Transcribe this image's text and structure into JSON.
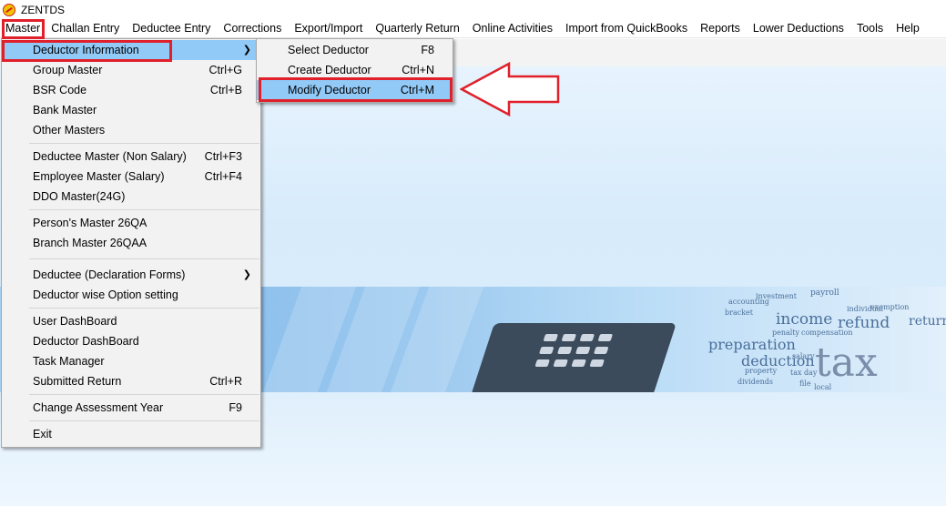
{
  "app": {
    "title": "ZENTDS",
    "icon": "app-logo-icon"
  },
  "menubar": [
    "Master",
    "Challan Entry",
    "Deductee Entry",
    "Corrections",
    "Export/Import",
    "Quarterly Return",
    "Online Activities",
    "Import from QuickBooks",
    "Reports",
    "Lower Deductions",
    "Tools",
    "Help"
  ],
  "master_menu": {
    "deductor_information": "Deductor Information",
    "group_master": {
      "label": "Group Master",
      "shortcut": "Ctrl+G"
    },
    "bsr_code": {
      "label": "BSR Code",
      "shortcut": "Ctrl+B"
    },
    "bank_master": "Bank Master",
    "other_masters": "Other Masters",
    "deductee_master_non_salary": {
      "label": "Deductee Master (Non Salary)",
      "shortcut": "Ctrl+F3"
    },
    "employee_master_salary": {
      "label": "Employee Master (Salary)",
      "shortcut": "Ctrl+F4"
    },
    "ddo_master": "DDO Master(24G)",
    "persons_master": "Person's Master 26QA",
    "branch_master": "Branch Master 26QAA",
    "deductee_declaration": "Deductee (Declaration Forms)",
    "deductor_option_setting": "Deductor wise Option setting",
    "user_dashboard": "User DashBoard",
    "deductor_dashboard": "Deductor DashBoard",
    "task_manager": "Task Manager",
    "submitted_return": {
      "label": "Submitted Return",
      "shortcut": "Ctrl+R"
    },
    "change_assessment_year": {
      "label": "Change Assessment Year",
      "shortcut": "F9"
    },
    "exit": "Exit"
  },
  "submenu": {
    "select_deductor": {
      "label": "Select Deductor",
      "shortcut": "F8"
    },
    "create_deductor": {
      "label": "Create Deductor",
      "shortcut": "Ctrl+N"
    },
    "modify_deductor": {
      "label": "Modify Deductor",
      "shortcut": "Ctrl+M"
    }
  },
  "banner_words": [
    "payroll",
    "investment",
    "accounting",
    "bracket",
    "income",
    "refund",
    "penalty",
    "compensation",
    "preparation",
    "deduction",
    "property",
    "tax day",
    "dividends",
    "salary",
    "tax",
    "file",
    "local",
    "return",
    "exemption",
    "individual"
  ],
  "colors": {
    "highlight": "#91c9f7",
    "annotation_red": "#e0202a",
    "menu_bg": "#f2f2f2",
    "workspace": "#d7ebfb"
  }
}
